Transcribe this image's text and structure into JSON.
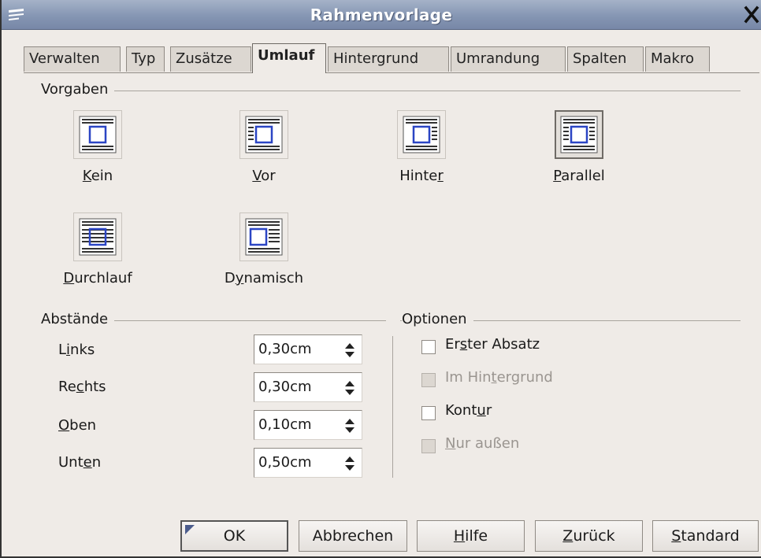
{
  "window": {
    "title": "Rahmenvorlage",
    "icons": {
      "menu": "window-menu-icon",
      "close": "close-icon"
    }
  },
  "tabs": [
    {
      "label": "Verwalten",
      "active": false
    },
    {
      "label": "Typ",
      "active": false
    },
    {
      "label": "Zusätze",
      "active": false
    },
    {
      "label": "Umlauf",
      "active": true
    },
    {
      "label": "Hintergrund",
      "active": false
    },
    {
      "label": "Umrandung",
      "active": false
    },
    {
      "label": "Spalten",
      "active": false
    },
    {
      "label": "Makro",
      "active": false
    }
  ],
  "vorgaben": {
    "label": "Vorgaben",
    "items": [
      {
        "pre": "",
        "key": "K",
        "post": "ein",
        "icon": "wrap-none-icon",
        "selected": false
      },
      {
        "pre": "",
        "key": "V",
        "post": "or",
        "icon": "wrap-before-icon",
        "selected": false
      },
      {
        "pre": "Hinte",
        "key": "r",
        "post": "",
        "icon": "wrap-after-icon",
        "selected": false
      },
      {
        "pre": "",
        "key": "P",
        "post": "arallel",
        "icon": "wrap-parallel-icon",
        "selected": true
      },
      {
        "pre": "",
        "key": "D",
        "post": "urchlauf",
        "icon": "wrap-through-icon",
        "selected": false
      },
      {
        "pre": "D",
        "key": "y",
        "post": "namisch",
        "icon": "wrap-dynamic-icon",
        "selected": false
      }
    ]
  },
  "abstaende": {
    "label": "Abstände",
    "fields": [
      {
        "pre": "L",
        "key": "i",
        "post": "nks",
        "value": "0,30cm"
      },
      {
        "pre": "Re",
        "key": "c",
        "post": "hts",
        "value": "0,30cm"
      },
      {
        "pre": "",
        "key": "O",
        "post": "ben",
        "value": "0,10cm"
      },
      {
        "pre": "Unt",
        "key": "e",
        "post": "n",
        "value": "0,50cm"
      }
    ]
  },
  "optionen": {
    "label": "Optionen",
    "items": [
      {
        "pre": "Er",
        "key": "s",
        "post": "ter Absatz",
        "checked": false,
        "enabled": true
      },
      {
        "pre": "Im Hin",
        "key": "t",
        "post": "ergrund",
        "checked": false,
        "enabled": false
      },
      {
        "pre": "Kont",
        "key": "u",
        "post": "r",
        "checked": false,
        "enabled": true
      },
      {
        "pre": "",
        "key": "N",
        "post": "ur außen",
        "checked": false,
        "enabled": false
      }
    ]
  },
  "buttons": {
    "ok": {
      "label": "OK"
    },
    "cancel": {
      "label": "Abbrechen"
    },
    "help": {
      "pre": "",
      "key": "H",
      "post": "ilfe"
    },
    "back": {
      "pre": "",
      "key": "Z",
      "post": "urück"
    },
    "standard": {
      "pre": "",
      "key": "S",
      "post": "tandard"
    }
  }
}
